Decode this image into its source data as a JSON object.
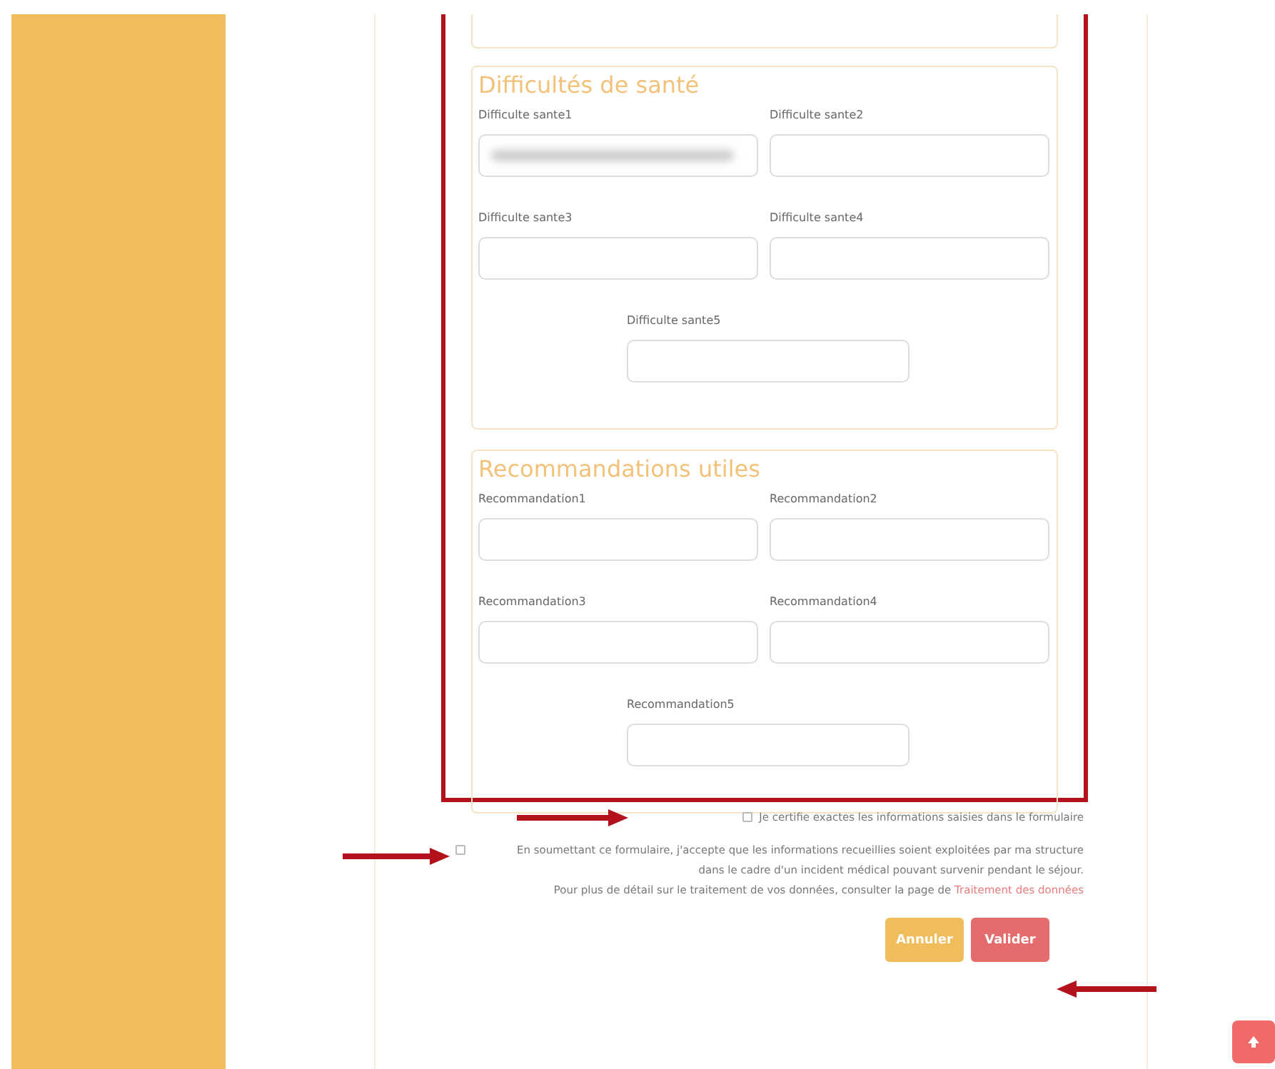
{
  "sections": [
    {
      "title": "Difficultés de santé",
      "fields": [
        {
          "label": "Difficulte sante1",
          "blurred": true
        },
        {
          "label": "Difficulte sante2",
          "blurred": false
        },
        {
          "label": "Difficulte sante3",
          "blurred": false
        },
        {
          "label": "Difficulte sante4",
          "blurred": false
        },
        {
          "label": "Difficulte sante5",
          "blurred": false
        }
      ]
    },
    {
      "title": "Recommandations utiles",
      "fields": [
        {
          "label": "Recommandation1",
          "blurred": false
        },
        {
          "label": "Recommandation2",
          "blurred": false
        },
        {
          "label": "Recommandation3",
          "blurred": false
        },
        {
          "label": "Recommandation4",
          "blurred": false
        },
        {
          "label": "Recommandation5",
          "blurred": false
        }
      ]
    }
  ],
  "certify": {
    "label": "Je certifie exactes les informations saisies dans le formulaire",
    "checked": false
  },
  "consent": {
    "text": "En soumettant ce formulaire, j'accepte que les informations recueillies soient exploitées par ma structure dans le cadre d'un incident médical pouvant survenir pendant le séjour.",
    "details": "Pour plus de détail sur le traitement de vos données, consulter la page de",
    "link": "Traitement des données",
    "checked": false
  },
  "buttons": [
    {
      "label": "Annuler",
      "kind": "cancel"
    },
    {
      "label": "Valider",
      "kind": "submit"
    }
  ]
}
